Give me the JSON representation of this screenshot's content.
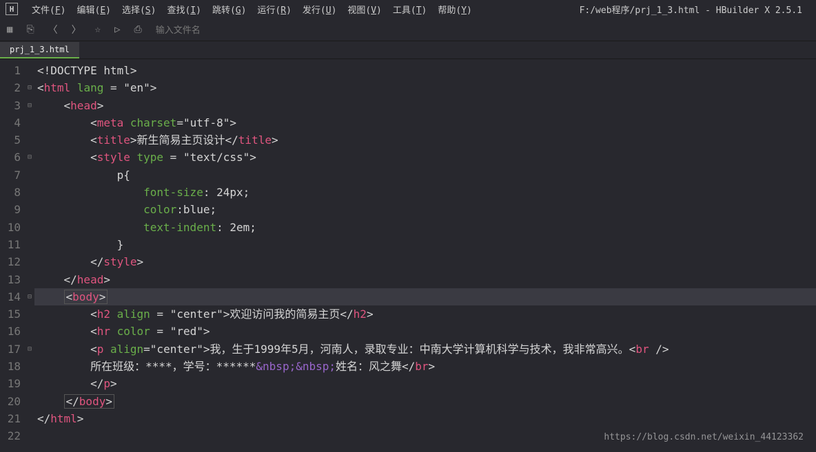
{
  "window": {
    "title": "F:/web程序/prj_1_3.html - HBuilder X 2.5.1"
  },
  "menu": [
    {
      "label": "文件",
      "key": "F"
    },
    {
      "label": "编辑",
      "key": "E"
    },
    {
      "label": "选择",
      "key": "S"
    },
    {
      "label": "查找",
      "key": "I"
    },
    {
      "label": "跳转",
      "key": "G"
    },
    {
      "label": "运行",
      "key": "R"
    },
    {
      "label": "发行",
      "key": "U"
    },
    {
      "label": "视图",
      "key": "V"
    },
    {
      "label": "工具",
      "key": "T"
    },
    {
      "label": "帮助",
      "key": "Y"
    }
  ],
  "toolbar": {
    "filename_placeholder": "输入文件名"
  },
  "tab": {
    "name": "prj_1_3.html"
  },
  "editor": {
    "highlighted_line": 14,
    "fold_markers": {
      "2": "⊟",
      "3": "⊟",
      "6": "⊟",
      "14": "⊟",
      "17": "⊟"
    },
    "lines": [
      {
        "n": 1,
        "tokens": [
          {
            "c": "t-bracket",
            "t": "<!"
          },
          {
            "c": "t-comment",
            "t": "DOCTYPE html"
          },
          {
            "c": "t-bracket",
            "t": ">"
          }
        ]
      },
      {
        "n": 2,
        "tokens": [
          {
            "c": "t-bracket",
            "t": "<"
          },
          {
            "c": "t-tag",
            "t": "html"
          },
          {
            "c": "",
            "t": " "
          },
          {
            "c": "t-attr",
            "t": "lang"
          },
          {
            "c": "",
            "t": " = "
          },
          {
            "c": "t-str",
            "t": "\"en\""
          },
          {
            "c": "t-bracket",
            "t": ">"
          }
        ]
      },
      {
        "n": 3,
        "indent": 4,
        "tokens": [
          {
            "c": "t-bracket",
            "t": "<"
          },
          {
            "c": "t-tag",
            "t": "head"
          },
          {
            "c": "t-bracket",
            "t": ">"
          }
        ]
      },
      {
        "n": 4,
        "indent": 8,
        "tokens": [
          {
            "c": "t-bracket",
            "t": "<"
          },
          {
            "c": "t-tag",
            "t": "meta"
          },
          {
            "c": "",
            "t": " "
          },
          {
            "c": "t-attr",
            "t": "charset"
          },
          {
            "c": "",
            "t": "="
          },
          {
            "c": "t-str",
            "t": "\"utf-8\""
          },
          {
            "c": "t-bracket",
            "t": ">"
          }
        ]
      },
      {
        "n": 5,
        "indent": 8,
        "tokens": [
          {
            "c": "t-bracket",
            "t": "<"
          },
          {
            "c": "t-tag",
            "t": "title"
          },
          {
            "c": "t-bracket",
            "t": ">"
          },
          {
            "c": "t-txt",
            "t": "新生简易主页设计"
          },
          {
            "c": "t-bracket",
            "t": "</"
          },
          {
            "c": "t-tag",
            "t": "title"
          },
          {
            "c": "t-bracket",
            "t": ">"
          }
        ]
      },
      {
        "n": 6,
        "indent": 8,
        "tokens": [
          {
            "c": "t-bracket",
            "t": "<"
          },
          {
            "c": "t-tag",
            "t": "style"
          },
          {
            "c": "",
            "t": " "
          },
          {
            "c": "t-attr",
            "t": "type"
          },
          {
            "c": "",
            "t": " = "
          },
          {
            "c": "t-str",
            "t": "\"text/css\""
          },
          {
            "c": "t-bracket",
            "t": ">"
          }
        ]
      },
      {
        "n": 7,
        "indent": 12,
        "tokens": [
          {
            "c": "t-txt",
            "t": "p{"
          }
        ]
      },
      {
        "n": 8,
        "indent": 16,
        "tokens": [
          {
            "c": "t-css-prop",
            "t": "font-size"
          },
          {
            "c": "t-txt",
            "t": ": 24px;"
          }
        ]
      },
      {
        "n": 9,
        "indent": 16,
        "tokens": [
          {
            "c": "t-css-prop",
            "t": "color"
          },
          {
            "c": "t-txt",
            "t": ":blue;"
          }
        ]
      },
      {
        "n": 10,
        "indent": 16,
        "tokens": [
          {
            "c": "t-css-prop",
            "t": "text-indent"
          },
          {
            "c": "t-txt",
            "t": ": 2em;"
          }
        ]
      },
      {
        "n": 11,
        "indent": 12,
        "tokens": [
          {
            "c": "t-txt",
            "t": "}"
          }
        ]
      },
      {
        "n": 12,
        "indent": 8,
        "tokens": [
          {
            "c": "t-bracket",
            "t": "</"
          },
          {
            "c": "t-tag",
            "t": "style"
          },
          {
            "c": "t-bracket",
            "t": ">"
          }
        ]
      },
      {
        "n": 13,
        "indent": 4,
        "tokens": [
          {
            "c": "t-bracket",
            "t": "</"
          },
          {
            "c": "t-tag",
            "t": "head"
          },
          {
            "c": "t-bracket",
            "t": ">"
          }
        ]
      },
      {
        "n": 14,
        "indent": 4,
        "tokens": [
          {
            "c": "t-bracket body-box",
            "t": "<"
          },
          {
            "c": "t-tag body-box",
            "t": "body"
          },
          {
            "c": "t-bracket body-box",
            "t": ">"
          }
        ],
        "boxed": true
      },
      {
        "n": 15,
        "indent": 8,
        "tokens": [
          {
            "c": "t-bracket",
            "t": "<"
          },
          {
            "c": "t-tag",
            "t": "h2"
          },
          {
            "c": "",
            "t": " "
          },
          {
            "c": "t-attr",
            "t": "align"
          },
          {
            "c": "",
            "t": " = "
          },
          {
            "c": "t-str",
            "t": "\"center\""
          },
          {
            "c": "t-bracket",
            "t": ">"
          },
          {
            "c": "t-txt",
            "t": "欢迎访问我的简易主页"
          },
          {
            "c": "t-bracket",
            "t": "</"
          },
          {
            "c": "t-tag",
            "t": "h2"
          },
          {
            "c": "t-bracket",
            "t": ">"
          }
        ]
      },
      {
        "n": 16,
        "indent": 8,
        "tokens": [
          {
            "c": "t-bracket",
            "t": "<"
          },
          {
            "c": "t-tag",
            "t": "hr"
          },
          {
            "c": "",
            "t": " "
          },
          {
            "c": "t-attr",
            "t": "color"
          },
          {
            "c": "",
            "t": " = "
          },
          {
            "c": "t-str",
            "t": "\"red\""
          },
          {
            "c": "t-bracket",
            "t": ">"
          }
        ]
      },
      {
        "n": 17,
        "indent": 8,
        "tokens": [
          {
            "c": "t-bracket",
            "t": "<"
          },
          {
            "c": "t-tag",
            "t": "p"
          },
          {
            "c": "",
            "t": " "
          },
          {
            "c": "t-attr",
            "t": "align"
          },
          {
            "c": "",
            "t": "="
          },
          {
            "c": "t-str",
            "t": "\"center\""
          },
          {
            "c": "t-bracket",
            "t": ">"
          },
          {
            "c": "t-txt",
            "t": "我，生于1999年5月，河南人，录取专业：中南大学计算机科学与技术，我非常高兴。"
          },
          {
            "c": "t-bracket",
            "t": "<"
          },
          {
            "c": "t-tag",
            "t": "br"
          },
          {
            "c": "",
            "t": " "
          },
          {
            "c": "t-bracket",
            "t": "/>"
          }
        ]
      },
      {
        "n": 18,
        "indent": 8,
        "tokens": [
          {
            "c": "t-txt",
            "t": "所在班级：****，学号：******"
          },
          {
            "c": "t-entity",
            "t": "&nbsp;&nbsp;"
          },
          {
            "c": "t-txt",
            "t": "姓名：风之舞"
          },
          {
            "c": "t-bracket",
            "t": "</"
          },
          {
            "c": "t-tag",
            "t": "br"
          },
          {
            "c": "t-bracket",
            "t": ">"
          }
        ]
      },
      {
        "n": 19,
        "indent": 8,
        "tokens": [
          {
            "c": "t-bracket",
            "t": "</"
          },
          {
            "c": "t-tag",
            "t": "p"
          },
          {
            "c": "t-bracket",
            "t": ">"
          }
        ]
      },
      {
        "n": 20,
        "indent": 4,
        "tokens": [
          {
            "c": "t-bracket body-box",
            "t": "</"
          },
          {
            "c": "t-tag body-box",
            "t": "body"
          },
          {
            "c": "t-bracket body-box",
            "t": ">"
          }
        ],
        "boxed": true
      },
      {
        "n": 21,
        "tokens": [
          {
            "c": "t-bracket",
            "t": "</"
          },
          {
            "c": "t-tag",
            "t": "html"
          },
          {
            "c": "t-bracket",
            "t": ">"
          }
        ]
      },
      {
        "n": 22,
        "tokens": []
      }
    ]
  },
  "watermark": "https://blog.csdn.net/weixin_44123362"
}
